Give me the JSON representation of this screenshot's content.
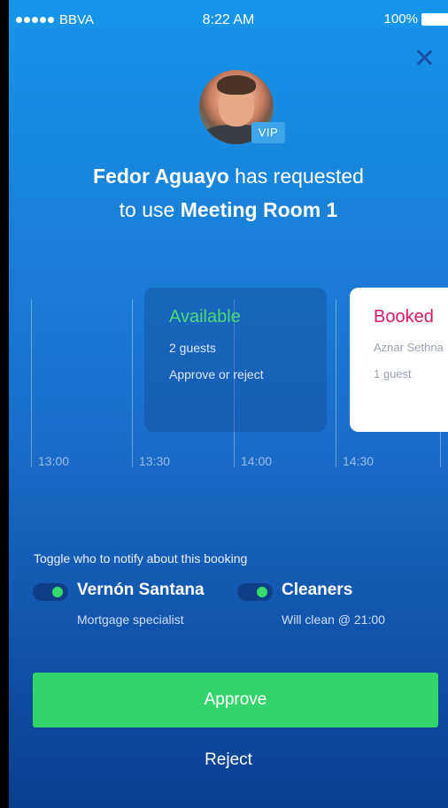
{
  "status_bar": {
    "carrier": "BBVA",
    "time": "8:22 AM",
    "battery": "100%"
  },
  "request": {
    "badge": "VIP",
    "requester": "Fedor Aguayo",
    "action_text": " has requested",
    "line2_prefix": "to use ",
    "room": "Meeting Room 1"
  },
  "timeline": {
    "ticks": [
      "13:00",
      "13:30",
      "14:00",
      "14:30"
    ],
    "available_slot": {
      "title": "Available",
      "guests": "2 guests",
      "hint": "Approve or reject"
    },
    "booked_slot": {
      "title": "Booked",
      "person": "Aznar Sethna",
      "guests": "1 guest"
    }
  },
  "notify": {
    "label": "Toggle who to notify about this booking",
    "people": [
      {
        "name": "Vernón Santana",
        "role": "Mortgage specialist",
        "enabled": true
      },
      {
        "name": "Cleaners",
        "role": "Will clean @ 21:00",
        "enabled": true
      }
    ]
  },
  "actions": {
    "approve": "Approve",
    "reject": "Reject"
  },
  "colors": {
    "available": "#4dd97a",
    "booked": "#d7196c",
    "approve_button": "#33d46a",
    "vip_badge": "#3ea5ea"
  }
}
